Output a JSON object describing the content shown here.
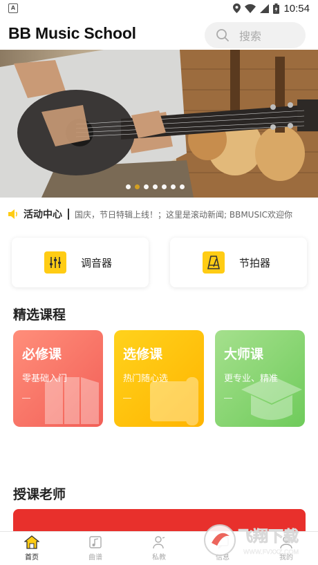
{
  "status_bar": {
    "time": "10:54"
  },
  "header": {
    "title": "BB Music School",
    "search_placeholder": "搜索"
  },
  "banner": {
    "slide_count": 7,
    "active_slide": 1
  },
  "notice": {
    "title": "活动中心",
    "text": "国庆，节日特辑上线！；这里是滚动新闻; BBMUSIC欢迎你"
  },
  "tools": [
    {
      "label": "调音器",
      "icon": "tuner-icon"
    },
    {
      "label": "节拍器",
      "icon": "metronome-icon"
    }
  ],
  "sections": {
    "courses": "精选课程",
    "teachers": "授课老师"
  },
  "courses": [
    {
      "name": "必修课",
      "subtitle": "零基础入门",
      "color_from": "#ff8e7a",
      "color_to": "#f25f57",
      "icon": "book-icon"
    },
    {
      "name": "选修课",
      "subtitle": "热门随心选",
      "color_from": "#ffd21c",
      "color_to": "#ffb400",
      "icon": "scroll-icon"
    },
    {
      "name": "大师课",
      "subtitle": "更专业、精准",
      "color_from": "#a5e08d",
      "color_to": "#6fcb5b",
      "icon": "graduation-cap-icon"
    }
  ],
  "bottom_nav": [
    {
      "label": "首页",
      "icon": "home-icon",
      "active": true
    },
    {
      "label": "曲谱",
      "icon": "sheet-music-icon",
      "active": false
    },
    {
      "label": "私教",
      "icon": "tutor-icon",
      "active": false
    },
    {
      "label": "信息",
      "icon": "message-icon",
      "active": false
    },
    {
      "label": "我的",
      "icon": "profile-icon",
      "active": false
    }
  ],
  "watermark": {
    "text": "飞翔下载",
    "url": "WWW.FVXXZ.COM"
  },
  "colors": {
    "accent": "#ffcc14",
    "teacher_banner": "#e8302c"
  }
}
